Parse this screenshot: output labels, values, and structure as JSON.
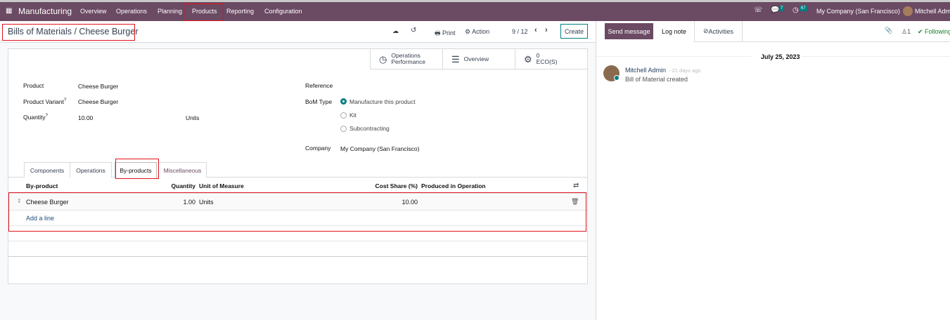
{
  "navbar": {
    "app": "Manufacturing",
    "menus": [
      "Overview",
      "Operations",
      "Planning",
      "Products",
      "Reporting",
      "Configuration"
    ],
    "messages_count": "7",
    "activities_count": "67",
    "company": "My Company (San Francisco)",
    "user": "Mitchell Admin",
    "color": "#6b4a63"
  },
  "control": {
    "breadcrumb": "Bills of Materials / Cheese Burger",
    "print": "Print",
    "action": "Action",
    "pager": "9 / 12",
    "create": "Create"
  },
  "buttonbox": {
    "ops_perf_1": "Operations",
    "ops_perf_2": "Performance",
    "overview": "Overview",
    "eco_count": "0",
    "eco_label": "ECO(S)"
  },
  "form": {
    "product_label": "Product",
    "product": "Cheese Burger",
    "variant_label": "Product Variant",
    "variant": "Cheese Burger",
    "qty_label": "Quantity",
    "qty": "10.00",
    "uom": "Units",
    "help": "?",
    "reference_label": "Reference",
    "bom_type_label": "BoM Type",
    "bom_types": [
      "Manufacture this product",
      "Kit",
      "Subcontracting"
    ],
    "bom_type_selected": "Manufacture this product",
    "company_label": "Company",
    "company": "My Company (San Francisco)"
  },
  "tabs": [
    "Components",
    "Operations",
    "By-products",
    "Miscellaneous"
  ],
  "active_tab": "By-products",
  "table": {
    "headers": [
      "By-product",
      "Quantity",
      "Unit of Measure",
      "Cost Share (%)",
      "Produced in Operation"
    ],
    "rows": [
      {
        "product": "Cheese Burger",
        "qty": "1.00",
        "uom": "Units",
        "cost_share": "10.00",
        "operation": ""
      }
    ],
    "add_line": "Add a line"
  },
  "chatter": {
    "send": "Send message",
    "log": "Log note",
    "activities": "Activities",
    "followers": "1",
    "following": "Following",
    "date": "July 25, 2023",
    "messages": [
      {
        "author": "Mitchell Admin",
        "time": "21 days ago",
        "body": "Bill of Material created"
      }
    ]
  },
  "accent": "#017e84"
}
